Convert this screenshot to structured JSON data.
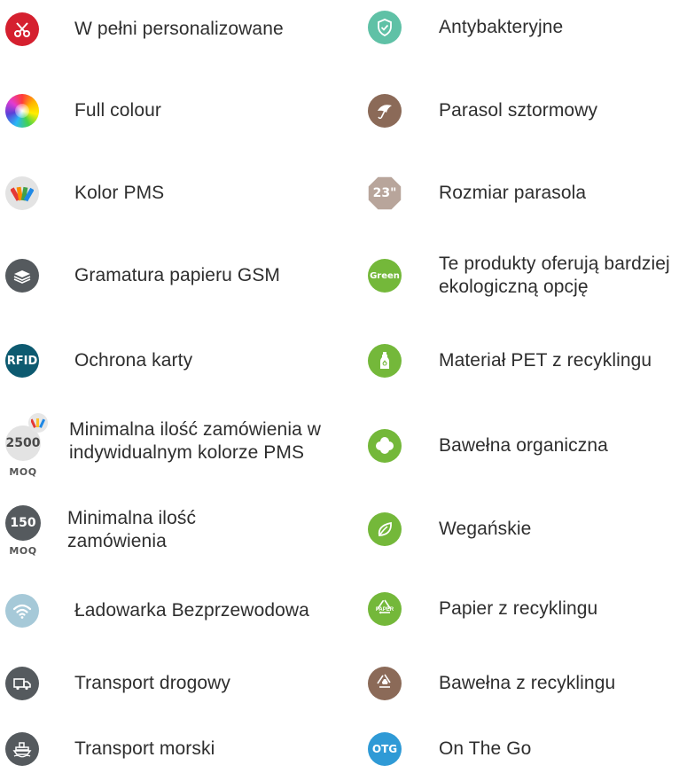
{
  "colors": {
    "red": "#d5202f",
    "teal": "#5fc1a6",
    "brown": "#8b6a58",
    "taupe": "#b8a59b",
    "grey": "#555a5e",
    "dark_teal": "#0d5a70",
    "light_grey": "#e3e3e3",
    "green": "#74b83a",
    "light_blue": "#a6c9d8",
    "blue": "#2f9ad6"
  },
  "left": [
    {
      "label": "W pełni personalizowane",
      "icon": "scissors-icon"
    },
    {
      "label": "Full colour",
      "icon": "color-wheel-icon"
    },
    {
      "label": "Kolor PMS",
      "icon": "color-fan-icon"
    },
    {
      "label": "Gramatura papieru GSM",
      "icon": "paper-stack-icon"
    },
    {
      "label": "Ochrona karty",
      "icon": "rfid-icon",
      "icon_text": "RFID"
    },
    {
      "label": "Minimalna ilość zamówienia w indywidualnym kolorze PMS",
      "icon": "moq-pms-icon",
      "icon_text": "2500",
      "icon_sub": "MOQ"
    },
    {
      "label": "Minimalna ilość zamówienia",
      "icon": "moq-icon",
      "icon_text": "150",
      "icon_sub": "MOQ"
    },
    {
      "label": "Ładowarka Bezprzewodowa",
      "icon": "wireless-icon"
    },
    {
      "label": "Transport drogowy",
      "icon": "truck-icon"
    },
    {
      "label": "Transport morski",
      "icon": "ship-icon"
    }
  ],
  "right": [
    {
      "label": "Antybakteryjne",
      "icon": "shield-check-icon"
    },
    {
      "label": "Parasol sztormowy",
      "icon": "storm-umbrella-icon"
    },
    {
      "label": "Rozmiar parasola",
      "icon": "umbrella-size-icon",
      "icon_text": "23\""
    },
    {
      "label": "Te produkty oferują bardziej ekologiczną opcję",
      "icon": "green-icon",
      "icon_text": "Green"
    },
    {
      "label": "Materiał PET z recyklingu",
      "icon": "pet-bottle-icon"
    },
    {
      "label": "Bawełna organiczna",
      "icon": "cotton-icon"
    },
    {
      "label": "Wegańskie",
      "icon": "vegan-leaf-icon"
    },
    {
      "label": "Papier z recyklingu",
      "icon": "recycle-paper-icon",
      "icon_text": "PAPER"
    },
    {
      "label": "Bawełna z recyklingu",
      "icon": "recycle-cotton-icon"
    },
    {
      "label": "On The Go",
      "icon": "otg-icon",
      "icon_text": "OTG"
    }
  ]
}
